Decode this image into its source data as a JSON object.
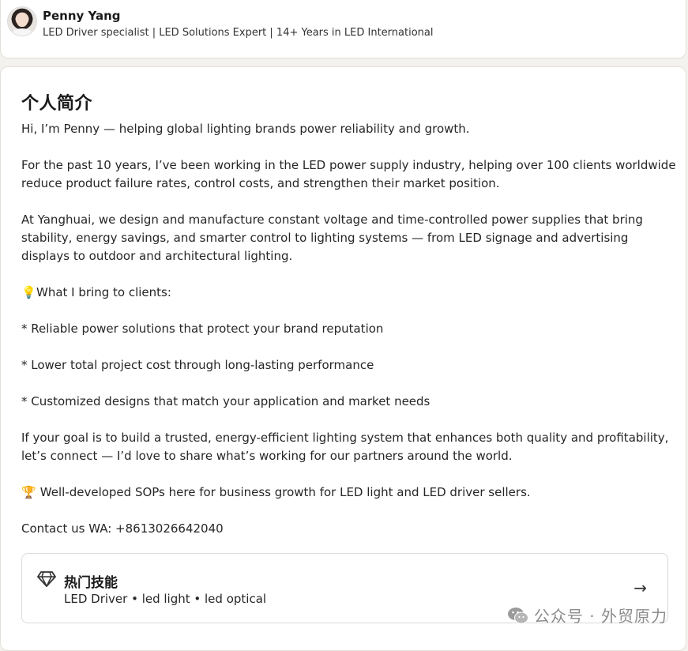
{
  "profile": {
    "name": "Penny Yang",
    "headline": "LED Driver specialist | LED Solutions Expert | 14+ Years in LED International"
  },
  "about": {
    "title": "个人简介",
    "lines": [
      "Hi, I’m Penny — helping global lighting brands power reliability and growth.",
      "For the past 10 years, I’ve been working in the LED power supply industry, helping over 100 clients worldwide reduce product failure rates, control costs, and strengthen their market position.",
      "At Yanghuai, we design and manufacture constant voltage and time-controlled power supplies that bring stability, energy savings, and smarter control to lighting systems — from LED signage and advertising displays to outdoor and architectural lighting.",
      "What I bring to clients:",
      "* Reliable power solutions that protect your brand reputation",
      "* Lower total project cost through long-lasting performance",
      "* Customized designs that match your application and market needs",
      "If your goal is to build a trusted, energy-efficient lighting system that enhances both quality and profitability, let’s connect — I’d love to share what’s working for our partners around the world.",
      "Well-developed SOPs here for business growth for  LED light and LED driver sellers.",
      "Contact us WA: +8613026642040"
    ],
    "icons": {
      "bulb": "lightbulb-icon",
      "trophy": "trophy-icon"
    }
  },
  "skills": {
    "title": "热门技能",
    "list": "LED Driver • led light • led optical",
    "icon": "diamond-icon",
    "arrow": "→"
  },
  "watermark": {
    "text": "公众号 · 外贸原力"
  }
}
